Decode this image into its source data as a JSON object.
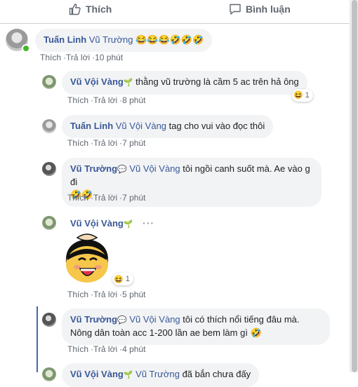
{
  "actions": {
    "like": "Thích",
    "comment": "Bình luận"
  },
  "comments": [
    {
      "author": "Tuấn Linh",
      "tag": "Vũ Trường",
      "text": "",
      "emojis": "😂😂😂🤣🤣🤣",
      "like": "Thích",
      "reply": "Trả lời",
      "time": "10 phút"
    },
    {
      "author": "Vũ Vội Vàng",
      "badge": "🌱",
      "tag": "",
      "text": "thằng vũ trường là cầm 5 ac trên hả ông",
      "reaction_emoji": "😆",
      "reaction_count": "1",
      "like": "Thích",
      "reply": "Trả lời",
      "time": "8 phút"
    },
    {
      "author": "Tuấn Linh",
      "tag": "Vũ Vội Vàng",
      "text": "tag cho vui vào đọc thôi",
      "like": "Thích",
      "reply": "Trả lời",
      "time": "7 phút"
    },
    {
      "author": "Vũ Trường",
      "badge": "💬",
      "tag": "Vũ Vội Vàng",
      "text": "tôi ngồi canh suốt mà. Ae vào g đi",
      "emojis": "🤣🤣",
      "like": "Thích",
      "reply": "Trả lời",
      "time": "7 phút"
    },
    {
      "author": "Vũ Vội Vàng",
      "badge": "🌱",
      "more": "···",
      "sticker": "laughing-girl-sticker",
      "reaction_emoji": "😆",
      "reaction_count": "1",
      "like": "Thích",
      "reply": "Trả lời",
      "time": "5 phút"
    },
    {
      "author": "Vũ Trường",
      "badge": "💬",
      "tag": "Vũ Vội Vàng",
      "text_line1": "tôi có thích nổi tiếng đâu mà.",
      "text_line2": "Nông dân toàn acc 1-200 lần ae bem làm gì",
      "emojis": "🤣",
      "like": "Thích",
      "reply": "Trả lời",
      "time": "4 phút"
    },
    {
      "author": "Vũ Vội Vàng",
      "badge": "🌱",
      "tag": "Vũ Trường",
      "text": "đã bắn chưa đấy"
    }
  ],
  "colors": {
    "link": "#385898",
    "meta": "#606770",
    "bubble": "#f2f3f5",
    "online": "#42b72a",
    "thread": "#4267b2"
  }
}
